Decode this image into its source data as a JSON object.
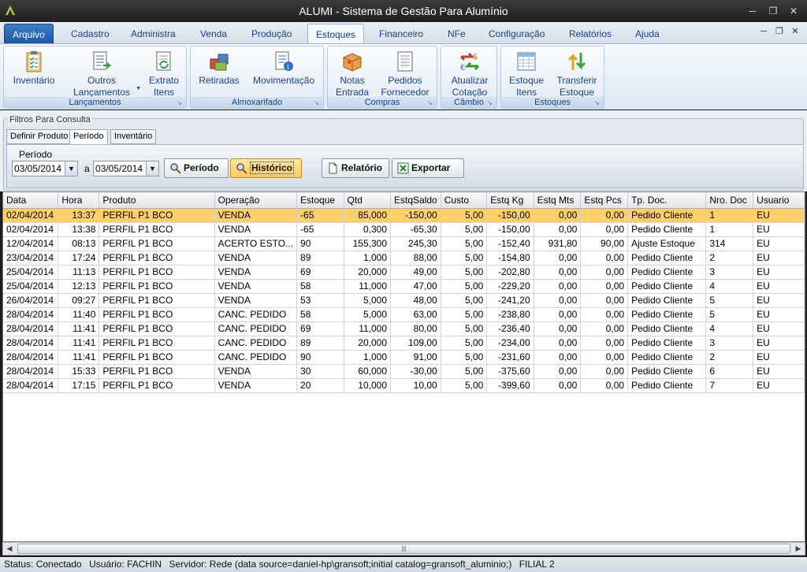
{
  "window": {
    "title": "ALUMI - Sistema de Gestão Para Alumínio"
  },
  "menu": {
    "tabs": [
      {
        "label": "Arquivo"
      },
      {
        "label": "Cadastro"
      },
      {
        "label": "Administra"
      },
      {
        "label": "Venda"
      },
      {
        "label": "Produção"
      },
      {
        "label": "Estoques"
      },
      {
        "label": "Financeiro"
      },
      {
        "label": "NFe"
      },
      {
        "label": "Configuração"
      },
      {
        "label": "Relatórios"
      },
      {
        "label": "Ajuda"
      }
    ],
    "active": "Estoques"
  },
  "ribbon": {
    "groups": [
      {
        "label": "Lançamentos",
        "buttons": [
          {
            "line1": "Inventário",
            "line2": "",
            "icon": "clipboard-checklist-icon"
          },
          {
            "line1": "Outros",
            "line2": "Lançamentos",
            "icon": "document-arrow-icon"
          },
          {
            "line1": "Extrato",
            "line2": "Itens",
            "icon": "document-refresh-icon"
          }
        ]
      },
      {
        "label": "Almoxarifado",
        "buttons": [
          {
            "line1": "Retiradas",
            "line2": "",
            "icon": "boxes-icon"
          },
          {
            "line1": "Movimentação",
            "line2": "",
            "icon": "document-info-icon"
          }
        ]
      },
      {
        "label": "Compras",
        "buttons": [
          {
            "line1": "Notas",
            "line2": "Entrada",
            "icon": "package-icon"
          },
          {
            "line1": "Pedidos",
            "line2": "Fornecedor",
            "icon": "order-sheet-icon"
          }
        ]
      },
      {
        "label": "Câmbio",
        "buttons": [
          {
            "line1": "Atualizar",
            "line2": "Cotação",
            "icon": "currency-exchange-icon"
          }
        ]
      },
      {
        "label": "Estoques",
        "buttons": [
          {
            "line1": "Estoque",
            "line2": "Itens",
            "icon": "spreadsheet-icon"
          },
          {
            "line1": "Transferir",
            "line2": "Estoque",
            "icon": "transfer-arrows-icon"
          }
        ]
      }
    ]
  },
  "filters": {
    "legend": "Filtros Para Consulta",
    "tabs": [
      {
        "label": "Definir Produto"
      },
      {
        "label": "Período"
      },
      {
        "label": "Inventário"
      }
    ],
    "active_tab": "Período",
    "period_label": "Período",
    "date_from": "03/05/2014",
    "separator": "a",
    "date_to": "03/05/2014",
    "buttons": {
      "periodo": "Período",
      "historico": "Histórico",
      "relatorio": "Relatório",
      "exportar": "Exportar"
    }
  },
  "grid": {
    "columns": [
      "Data",
      "Hora",
      "Produto",
      "Operação",
      "Estoque",
      "Qtd",
      "EstqSaldo",
      "Custo",
      "Estq Kg",
      "Estq Mts",
      "Estq Pcs",
      "Tp. Doc.",
      "Nro. Doc",
      "Usuario"
    ],
    "rows": [
      [
        "02/04/2014",
        "13:37",
        "PERFIL P1 BCO",
        "VENDA",
        "-65",
        "85,000",
        "-150,00",
        "5,00",
        "-150,00",
        "0,00",
        "0,00",
        "Pedido Cliente",
        "1",
        "EU"
      ],
      [
        "02/04/2014",
        "13:38",
        "PERFIL P1 BCO",
        "VENDA",
        "-65",
        "0,300",
        "-65,30",
        "5,00",
        "-150,00",
        "0,00",
        "0,00",
        "Pedido Cliente",
        "1",
        "EU"
      ],
      [
        "12/04/2014",
        "08:13",
        "PERFIL P1 BCO",
        "ACERTO ESTO...",
        "90",
        "155,300",
        "245,30",
        "5,00",
        "-152,40",
        "931,80",
        "90,00",
        "Ajuste Estoque",
        "314",
        "EU"
      ],
      [
        "23/04/2014",
        "17:24",
        "PERFIL P1 BCO",
        "VENDA",
        "89",
        "1,000",
        "88,00",
        "5,00",
        "-154,80",
        "0,00",
        "0,00",
        "Pedido Cliente",
        "2",
        "EU"
      ],
      [
        "25/04/2014",
        "11:13",
        "PERFIL P1 BCO",
        "VENDA",
        "69",
        "20,000",
        "49,00",
        "5,00",
        "-202,80",
        "0,00",
        "0,00",
        "Pedido Cliente",
        "3",
        "EU"
      ],
      [
        "25/04/2014",
        "12:13",
        "PERFIL P1 BCO",
        "VENDA",
        "58",
        "11,000",
        "47,00",
        "5,00",
        "-229,20",
        "0,00",
        "0,00",
        "Pedido Cliente",
        "4",
        "EU"
      ],
      [
        "26/04/2014",
        "09:27",
        "PERFIL P1 BCO",
        "VENDA",
        "53",
        "5,000",
        "48,00",
        "5,00",
        "-241,20",
        "0,00",
        "0,00",
        "Pedido Cliente",
        "5",
        "EU"
      ],
      [
        "28/04/2014",
        "11:40",
        "PERFIL P1 BCO",
        "CANC. PEDIDO",
        "58",
        "5,000",
        "63,00",
        "5,00",
        "-238,80",
        "0,00",
        "0,00",
        "Pedido Cliente",
        "5",
        "EU"
      ],
      [
        "28/04/2014",
        "11:41",
        "PERFIL P1 BCO",
        "CANC. PEDIDO",
        "69",
        "11,000",
        "80,00",
        "5,00",
        "-236,40",
        "0,00",
        "0,00",
        "Pedido Cliente",
        "4",
        "EU"
      ],
      [
        "28/04/2014",
        "11:41",
        "PERFIL P1 BCO",
        "CANC. PEDIDO",
        "89",
        "20,000",
        "109,00",
        "5,00",
        "-234,00",
        "0,00",
        "0,00",
        "Pedido Cliente",
        "3",
        "EU"
      ],
      [
        "28/04/2014",
        "11:41",
        "PERFIL P1 BCO",
        "CANC. PEDIDO",
        "90",
        "1,000",
        "91,00",
        "5,00",
        "-231,60",
        "0,00",
        "0,00",
        "Pedido Cliente",
        "2",
        "EU"
      ],
      [
        "28/04/2014",
        "15:33",
        "PERFIL P1 BCO",
        "VENDA",
        "30",
        "60,000",
        "-30,00",
        "5,00",
        "-375,60",
        "0,00",
        "0,00",
        "Pedido Cliente",
        "6",
        "EU"
      ],
      [
        "28/04/2014",
        "17:15",
        "PERFIL P1 BCO",
        "VENDA",
        "20",
        "10,000",
        "10,00",
        "5,00",
        "-399,60",
        "0,00",
        "0,00",
        "Pedido Cliente",
        "7",
        "EU"
      ]
    ],
    "selected_row": 0
  },
  "status": {
    "status": "Status: Conectado",
    "user": "Usuário: FACHIN",
    "server": "Servidor: Rede (data source=daniel-hp\\gransoft;initial catalog=gransoft_aluminio;)",
    "branch": "FILIAL 2"
  },
  "colors": {
    "selected_row": "#ffcf6a",
    "accent": "#15428b",
    "title_bar": "#2a2a2a"
  }
}
